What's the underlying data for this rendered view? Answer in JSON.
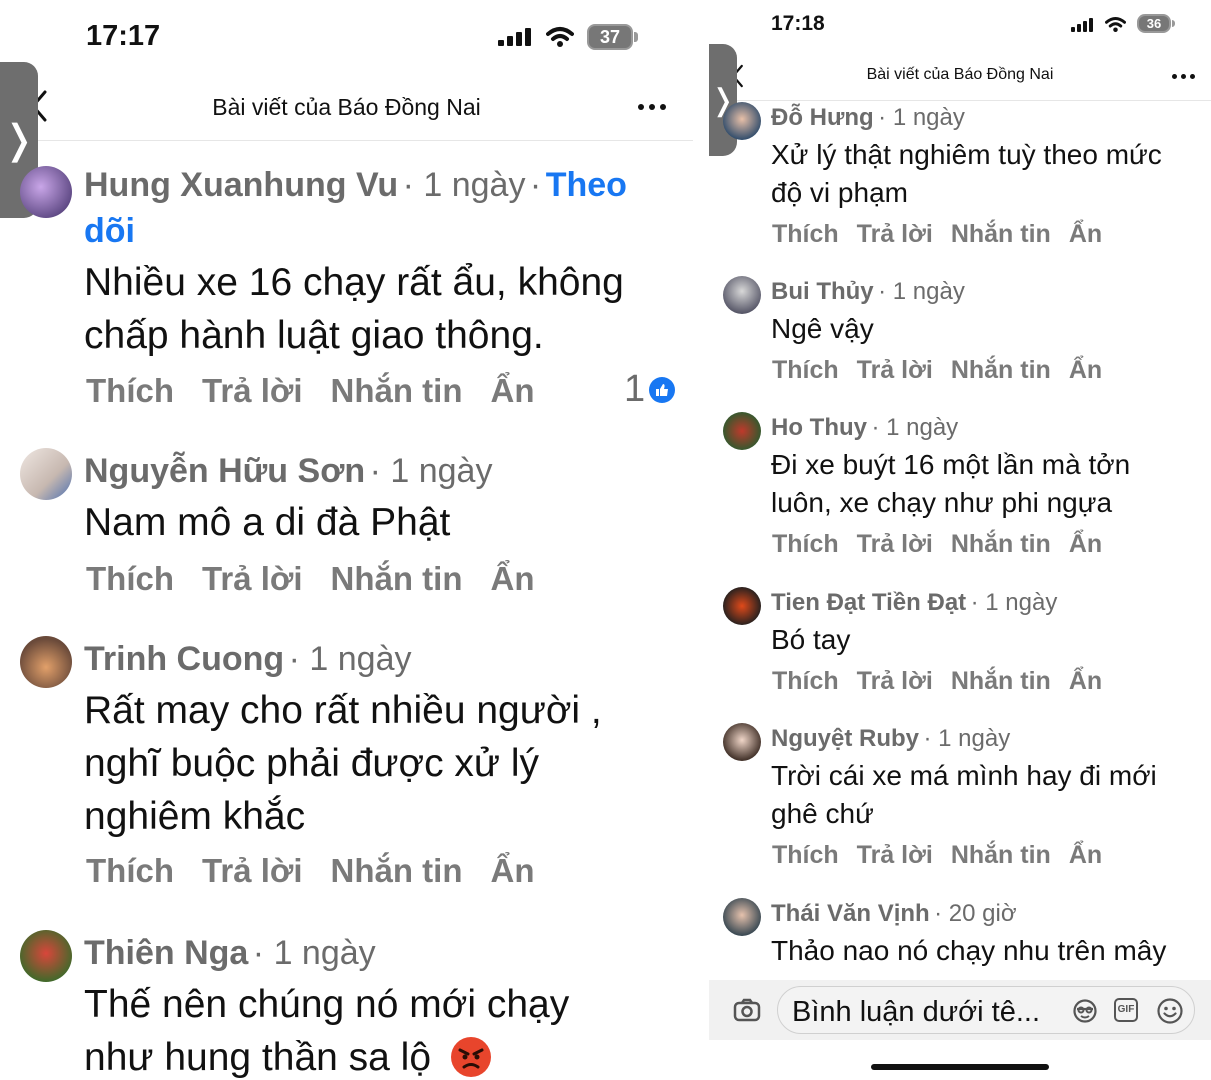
{
  "left": {
    "status": {
      "time": "17:17",
      "battery": "37"
    },
    "nav": {
      "title": "Bài viết của Báo Đồng Nai"
    },
    "comments": [
      {
        "name": "Hung Xuanhung Vu",
        "time": "· 1 ngày",
        "follow_dot": "·",
        "follow_1": "Theo",
        "follow_2": "dõi",
        "lines": [
          "Nhiều xe 16 chạy rất ẩu, không",
          "chấp hành luật giao thông."
        ],
        "reactions": "1"
      },
      {
        "name": "Nguyễn Hữu Sơn",
        "time": "· 1 ngày",
        "lines": [
          "Nam mô a di đà Phật"
        ]
      },
      {
        "name": "Trinh Cuong",
        "time": "· 1 ngày",
        "lines": [
          "Rất may cho rất nhiều người ,",
          "nghĩ buộc phải được xử lý",
          "nghiêm khắc"
        ]
      },
      {
        "name": "Thiên Nga",
        "time": "· 1 ngày",
        "lines": [
          "Thế nên chúng nó mới chạy",
          "như hung thần sa lộ"
        ]
      }
    ]
  },
  "right": {
    "status": {
      "time": "17:18",
      "battery": "36"
    },
    "nav": {
      "title": "Bài viết của Báo Đồng Nai"
    },
    "comments": [
      {
        "name": "Đỗ Hưng",
        "time": "· 1 ngày",
        "lines": [
          "Xử lý thật nghiêm tuỳ theo mức",
          "độ vi phạm"
        ]
      },
      {
        "name": "Bui Thủy",
        "time": "· 1 ngày",
        "lines": [
          "Ngê vậy"
        ]
      },
      {
        "name": "Ho Thuy",
        "time": "· 1 ngày",
        "lines": [
          "Đi xe buýt 16 một lần mà tởn",
          "luôn, xe chạy như phi ngựa"
        ]
      },
      {
        "name": "Tien Đạt Tiền Đạt",
        "time": "· 1 ngày",
        "lines": [
          "Bó tay"
        ]
      },
      {
        "name": "Nguyệt Ruby",
        "time": "· 1 ngày",
        "lines": [
          "Trời cái xe má mình hay đi mới",
          "ghê chứ"
        ]
      },
      {
        "name": "Thái Văn Vịnh",
        "time": "· 20 giờ",
        "lines": [
          "Thảo nao nó chạy nhu trên mây"
        ]
      }
    ],
    "composer": {
      "placeholder": "Bình luận dưới tê...",
      "gif_label": "GIF"
    }
  },
  "actions": {
    "like": "Thích",
    "reply": "Trả lời",
    "message": "Nhắn tin",
    "hide": "Ẩn"
  },
  "colors": {
    "name_gray": "#6b6b6b",
    "action_gray": "#7a7a7a",
    "link_blue": "#1877f2",
    "text": "#111111",
    "handle": "#6e6e6e"
  },
  "icons": [
    "back-chevron-icon",
    "more-icon",
    "signal-icon",
    "wifi-icon",
    "battery-icon",
    "like-icon",
    "angry-emoji-icon",
    "camera-icon",
    "sticker-icon",
    "gif-icon",
    "emoji-icon"
  ]
}
